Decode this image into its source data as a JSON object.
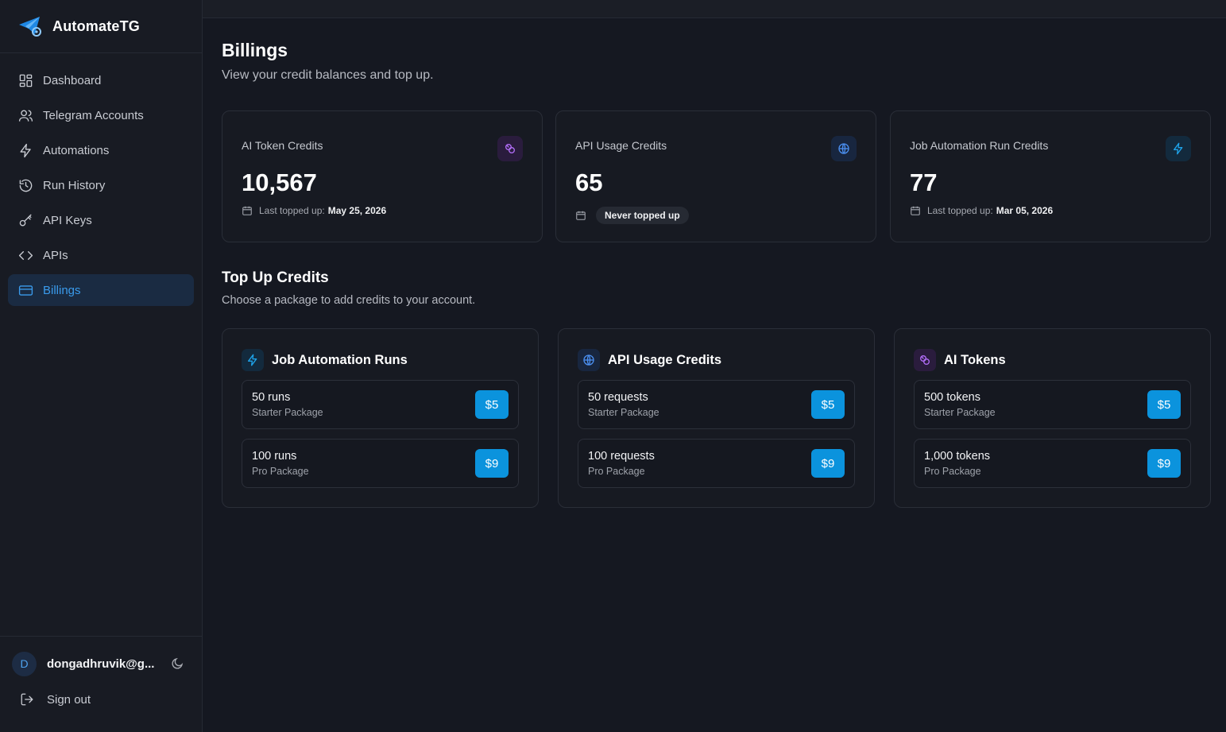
{
  "app": {
    "name": "AutomateTG"
  },
  "nav": [
    {
      "label": "Dashboard",
      "icon": "dashboard-icon"
    },
    {
      "label": "Telegram Accounts",
      "icon": "users-icon"
    },
    {
      "label": "Automations",
      "icon": "zap-icon"
    },
    {
      "label": "Run History",
      "icon": "history-icon"
    },
    {
      "label": "API Keys",
      "icon": "key-icon"
    },
    {
      "label": "APIs",
      "icon": "code-icon"
    },
    {
      "label": "Billings",
      "icon": "credit-card-icon",
      "active": true
    }
  ],
  "user": {
    "initial": "D",
    "email": "dongadhruvik@g..."
  },
  "signout": {
    "label": "Sign out"
  },
  "page": {
    "title": "Billings",
    "subtitle": "View your credit balances and top up."
  },
  "stats": [
    {
      "label": "AI Token Credits",
      "value": "10,567",
      "meta_label": "Last topped up:",
      "meta_value": "May 25, 2026",
      "icon": "ai-icon",
      "accent": "#a855f7"
    },
    {
      "label": "API Usage Credits",
      "value": "65",
      "meta_value": "Never topped up",
      "icon": "globe-icon",
      "accent": "#3b82f6"
    },
    {
      "label": "Job Automation Run Credits",
      "value": "77",
      "meta_label": "Last topped up:",
      "meta_value": "Mar 05, 2026",
      "icon": "zap-icon",
      "accent": "#0ea5e9"
    }
  ],
  "topup": {
    "title": "Top Up Credits",
    "subtitle": "Choose a package to add credits to your account."
  },
  "packages": [
    {
      "title": "Job Automation Runs",
      "icon": "zap-icon",
      "options": [
        {
          "name": "50 runs",
          "tier": "Starter Package",
          "price": "$5"
        },
        {
          "name": "100 runs",
          "tier": "Pro Package",
          "price": "$9"
        }
      ]
    },
    {
      "title": "API Usage Credits",
      "icon": "globe-icon",
      "options": [
        {
          "name": "50 requests",
          "tier": "Starter Package",
          "price": "$5"
        },
        {
          "name": "100 requests",
          "tier": "Pro Package",
          "price": "$9"
        }
      ]
    },
    {
      "title": "AI Tokens",
      "icon": "ai-icon",
      "options": [
        {
          "name": "500 tokens",
          "tier": "Starter Package",
          "price": "$5"
        },
        {
          "name": "1,000 tokens",
          "tier": "Pro Package",
          "price": "$9"
        }
      ]
    }
  ],
  "colors": {
    "accent": "#0b93dd",
    "active_nav": "#3a9bec",
    "background": "#151821"
  }
}
